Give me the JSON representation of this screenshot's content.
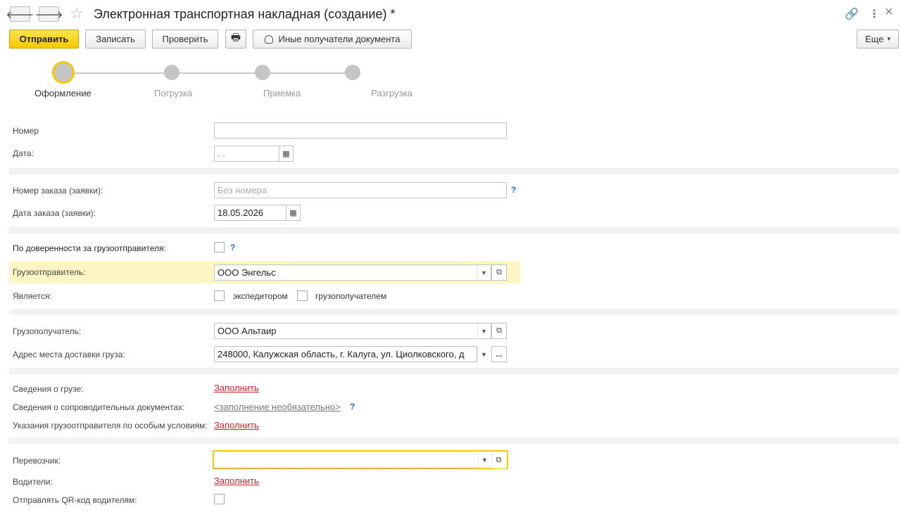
{
  "window": {
    "title": "Электронная транспортная накладная (создание) *",
    "back_glyph": "🡐",
    "forward_glyph": "🡒",
    "star_glyph": "☆",
    "link_glyph": "🔗",
    "more_glyph": "⋮",
    "close_glyph": "×"
  },
  "toolbar": {
    "send": "Отправить",
    "save": "Записать",
    "check": "Проверить",
    "print_glyph": "🖶",
    "other_recipients": "Иные получатели документа",
    "more": "Еще",
    "more_arrow": "▾"
  },
  "steps": [
    {
      "label": "Оформление",
      "active": true
    },
    {
      "label": "Погрузка",
      "active": false
    },
    {
      "label": "Приемка",
      "active": false
    },
    {
      "label": "Разгрузка",
      "active": false
    }
  ],
  "form": {
    "number": {
      "label": "Номер",
      "value": ""
    },
    "date": {
      "label": "Дата:",
      "value": " .  ."
    },
    "order_number": {
      "label": "Номер заказа (заявки):",
      "placeholder": "Без номера"
    },
    "order_date": {
      "label": "Дата заказа (заявки):",
      "value": "18.05.2026"
    },
    "by_proxy": {
      "label": "По доверенности за грузоотправителя:",
      "checked": false
    },
    "shipper": {
      "label": "Грузоотправитель:",
      "value": "ООО Энгельс"
    },
    "is": {
      "label": "Является:",
      "forwarder": "экспедитором",
      "consignee": "грузополучателем"
    },
    "consignee": {
      "label": "Грузополучатель:",
      "value": "ООО Альтаир"
    },
    "delivery_address": {
      "label": "Адрес места доставки груза:",
      "value": "248000, Калужская область, г. Калуга, ул. Циолковского, д"
    },
    "cargo_info": {
      "label": "Сведения о грузе:",
      "link": "Заполнить"
    },
    "accompanying_docs": {
      "label": "Сведения о сопроводительных документах:",
      "link": "<заполнение необязательно>"
    },
    "special_conditions": {
      "label": "Указания грузоотправителя по особым условиям:",
      "link": "Заполнить"
    },
    "carrier": {
      "label": "Перевозчик:",
      "value": ""
    },
    "drivers": {
      "label": "Водители:",
      "link": "Заполнить"
    },
    "send_qr": {
      "label": "Отправлять QR-код водителям:",
      "checked": false
    }
  },
  "glyphs": {
    "help": "?",
    "calendar": "▦",
    "dropdown": "▼",
    "open": "⧉",
    "ellipsis": "..."
  }
}
